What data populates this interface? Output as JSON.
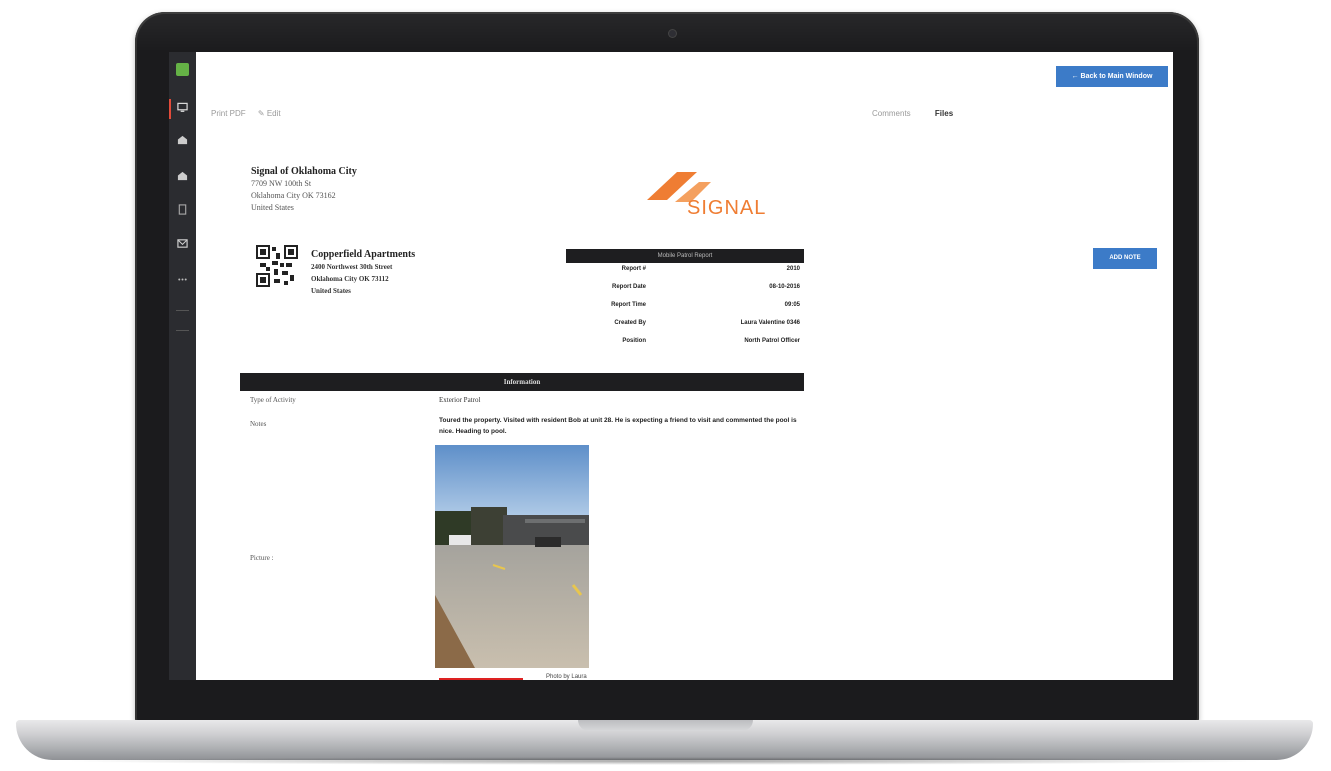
{
  "header": {
    "back_button": "Back to Main Window",
    "toolbar_left": [
      "Print PDF",
      "Edit"
    ],
    "tabs": [
      "Comments",
      "Files"
    ]
  },
  "company": {
    "name": "Signal of Oklahoma City",
    "address_lines": [
      "7709 NW 100th St",
      "Oklahoma City OK 73162",
      "United States"
    ]
  },
  "logo_text": "SIGNAL",
  "site": {
    "name": "Copperfield Apartments",
    "address_lines": [
      "2400 Northwest 30th Street",
      "Oklahoma City OK 73112",
      "United States"
    ]
  },
  "report": {
    "title": "Mobile Patrol Report",
    "rows": [
      {
        "label": "Report #",
        "value": "2010"
      },
      {
        "label": "Report Date",
        "value": "08-10-2016"
      },
      {
        "label": "Report Time",
        "value": "09:05"
      },
      {
        "label": "Created By",
        "value": "Laura Valentine 0346"
      },
      {
        "label": "Position",
        "value": "North Patrol Officer"
      }
    ]
  },
  "add_note_button": "ADD NOTE",
  "information": {
    "title": "Information",
    "type_label": "Type of Activity",
    "type_value": "Exterior Patrol",
    "notes_label": "Notes",
    "notes_value": "Toured the property. Visited with resident Bob at unit 28. He is expecting a friend to visit and commented the pool is nice. Heading to pool.",
    "picture_label": "Picture :",
    "picture_caption": "Photo by Laura"
  },
  "colors": {
    "accent_blue": "#3c7bc8",
    "brand_orange": "#ef7d33",
    "sidebar_bg": "#2b2c30",
    "header_bar": "#1e1e20"
  },
  "sidebar_icons": [
    "app-logo-icon",
    "monitor-icon",
    "building-icon",
    "building-icon",
    "document-icon",
    "mail-icon",
    "more-icon"
  ]
}
